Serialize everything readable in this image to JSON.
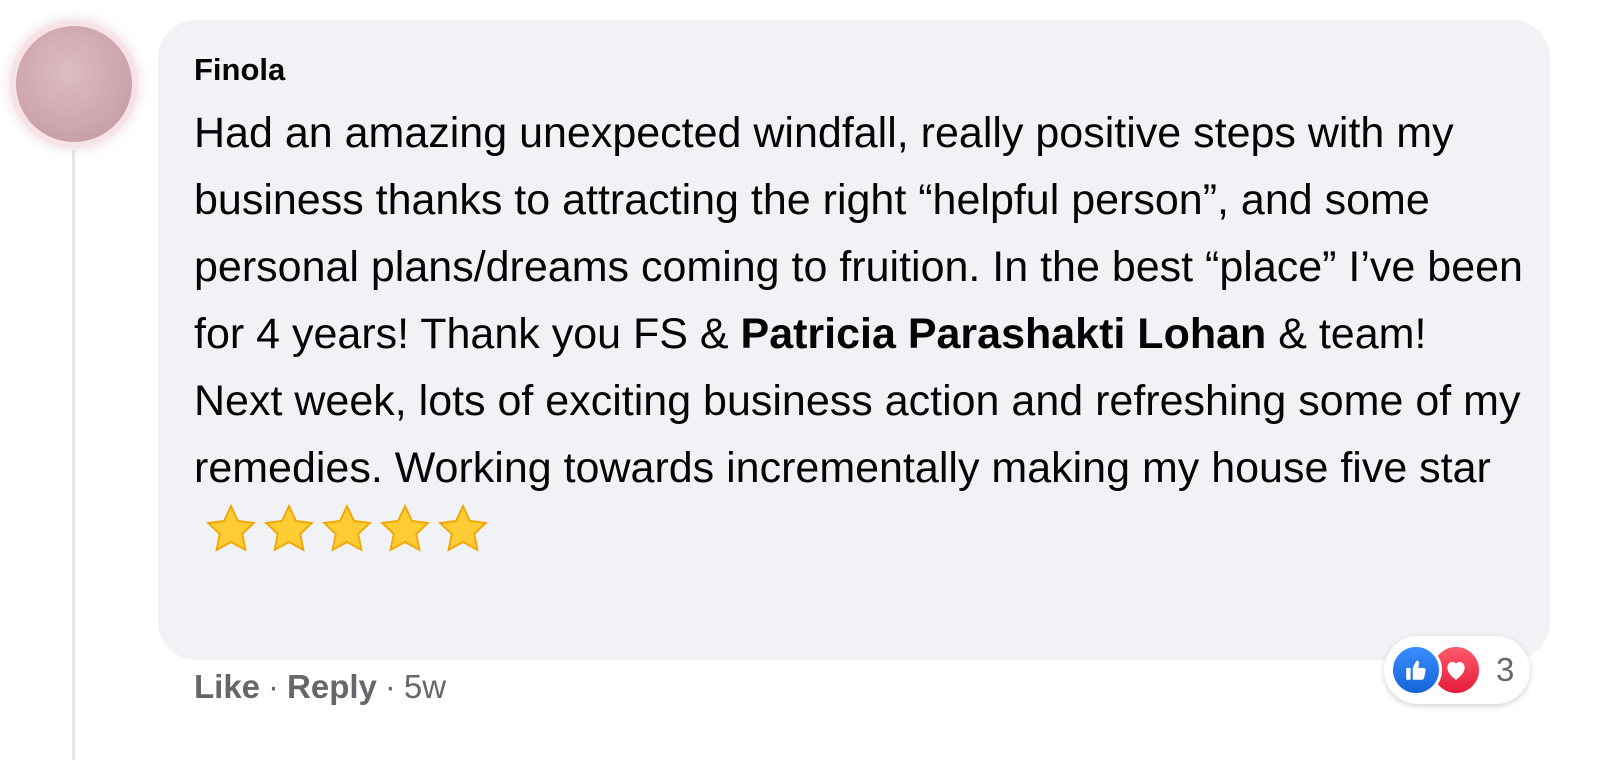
{
  "comment": {
    "author": "Finola",
    "text_before_mention": "Had an amazing unexpected windfall, really positive steps with my business thanks to attracting the right “helpful person”, and some personal plans/dreams coming to fruition. In the best “place” I’ve been for 4 years! Thank you FS & ",
    "mention": "Patricia Parashakti Lohan",
    "text_after_mention": " & team! Next week, lots of exciting business action and refreshing some of my remedies. Working towards incrementally making my house five star",
    "star_emoji_count": 5
  },
  "actions": {
    "like_label": "Like",
    "separator": "·",
    "reply_label": "Reply",
    "timestamp": "5w"
  },
  "reactions": {
    "types": [
      "like-icon",
      "love-icon"
    ],
    "count": "3"
  },
  "colors": {
    "bubble": "#f0f2f5",
    "secondary_text": "#65676b",
    "like": "#1877f2",
    "love": "#f33e58",
    "star": "#ffcc33"
  }
}
